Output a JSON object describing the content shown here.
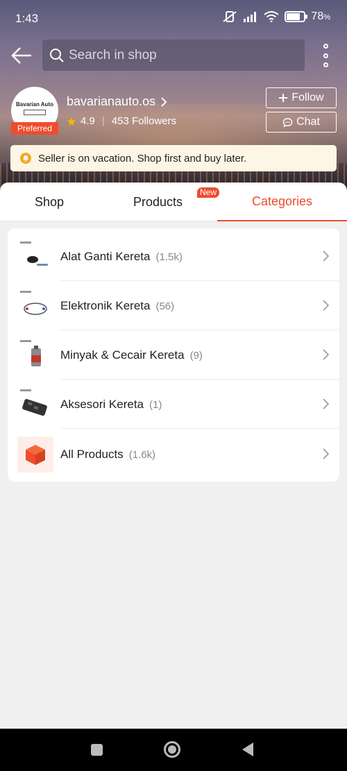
{
  "status_bar": {
    "time": "1:43",
    "battery": "78",
    "battery_unit": "%",
    "battery_level": 0.78
  },
  "search": {
    "placeholder": "Search in shop"
  },
  "shop": {
    "logo_text": "Bavarian Auto",
    "name": "bavarianauto.os",
    "preferred_label": "Preferred",
    "rating": "4.9",
    "followers": "453 Followers",
    "follow_label": "Follow",
    "chat_label": "Chat"
  },
  "vacation_notice": "Seller is on vacation. Shop first and buy later.",
  "tabs": [
    {
      "label": "Shop",
      "active": false
    },
    {
      "label": "Products",
      "active": false,
      "badge": "New"
    },
    {
      "label": "Categories",
      "active": true
    }
  ],
  "categories": [
    {
      "label": "Alat Ganti Kereta",
      "count": "(1.5k)"
    },
    {
      "label": "Elektronik Kereta",
      "count": "(56)"
    },
    {
      "label": "Minyak & Cecair Kereta",
      "count": "(9)"
    },
    {
      "label": "Aksesori Kereta",
      "count": "(1)"
    },
    {
      "label": "All Products",
      "count": "(1.6k)"
    }
  ],
  "colors": {
    "accent": "#ee4d2d",
    "star": "#f5b400",
    "vacation_bg": "#fef6e4"
  }
}
